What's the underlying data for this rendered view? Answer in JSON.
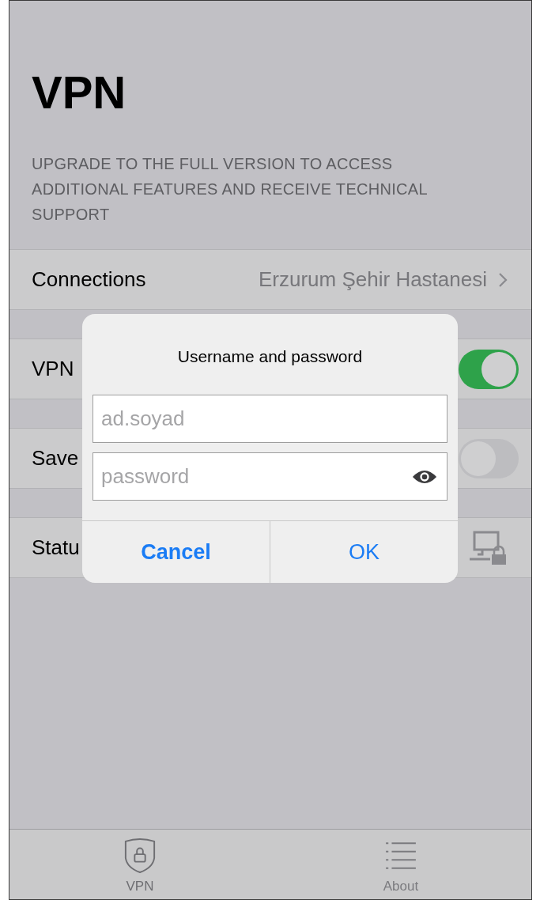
{
  "header": {
    "title": "VPN",
    "notice": "UPGRADE TO THE FULL VERSION TO ACCESS ADDITIONAL FEATURES AND RECEIVE TECHNICAL SUPPORT"
  },
  "rows": [
    {
      "kind": "link",
      "label": "Connections",
      "value": "Erzurum Şehir Hastanesi"
    },
    {
      "kind": "toggle",
      "label": "VPN",
      "on": true
    },
    {
      "kind": "toggle",
      "label": "Save",
      "on": false
    },
    {
      "kind": "status",
      "label": "Statu"
    }
  ],
  "dialog": {
    "title": "Username and password",
    "fields": [
      {
        "kind": "text",
        "placeholder": "ad.soyad"
      },
      {
        "kind": "password",
        "placeholder": "password"
      }
    ],
    "buttons": [
      {
        "kind": "cancel",
        "label": "Cancel"
      },
      {
        "kind": "default",
        "label": "OK"
      }
    ]
  },
  "tab_bar": [
    {
      "kind": "shield",
      "label": "VPN",
      "selected": true
    },
    {
      "kind": "list",
      "label": "About",
      "selected": false
    }
  ]
}
